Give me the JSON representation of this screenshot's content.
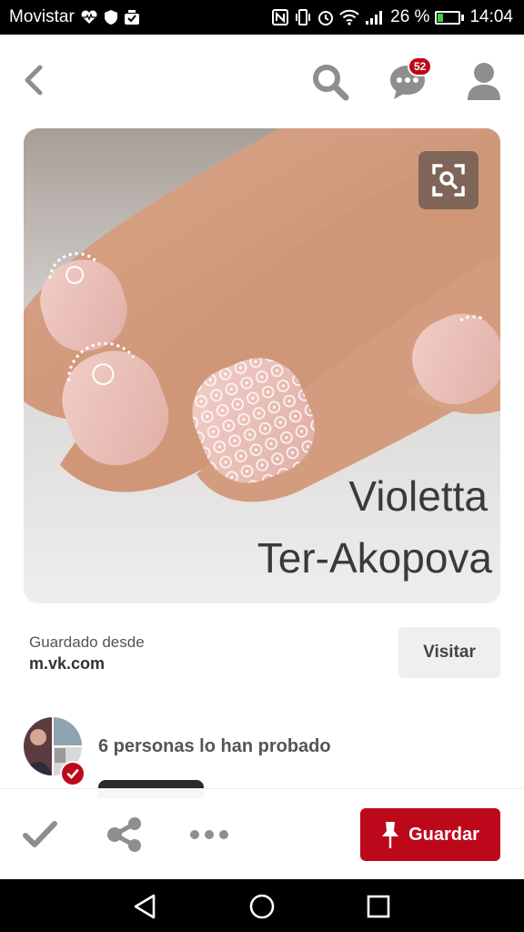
{
  "status_bar": {
    "carrier": "Movistar",
    "battery_percent": "26 %",
    "battery_level": 0.26,
    "time": "14:04",
    "icons": [
      "heart-pulse-icon",
      "shield-icon",
      "download-icon",
      "nfc-icon",
      "vibrate-icon",
      "alarm-icon",
      "wifi-icon",
      "signal-icon",
      "battery-icon"
    ]
  },
  "header": {
    "icons": [
      "back-icon",
      "search-icon",
      "messages-icon",
      "profile-icon"
    ],
    "messages_badge": "52"
  },
  "pin": {
    "image_watermark_line1": "Violetta",
    "image_watermark_line2": "Ter-Akopova",
    "visual_search_icon": "visual-search-icon"
  },
  "source": {
    "caption": "Guardado desde",
    "domain": "m.vk.com",
    "visit_label": "Visitar"
  },
  "tried": {
    "label": "6 personas lo han probado"
  },
  "actions": {
    "icons": [
      "check-icon",
      "share-icon",
      "more-icon",
      "pin-icon"
    ],
    "save_label": "Guardar"
  },
  "nav": {
    "icons": [
      "back-triangle-icon",
      "home-circle-icon",
      "recents-square-icon"
    ]
  },
  "colors": {
    "brand_red": "#bd081c",
    "icon_gray": "#8e8e8e"
  }
}
